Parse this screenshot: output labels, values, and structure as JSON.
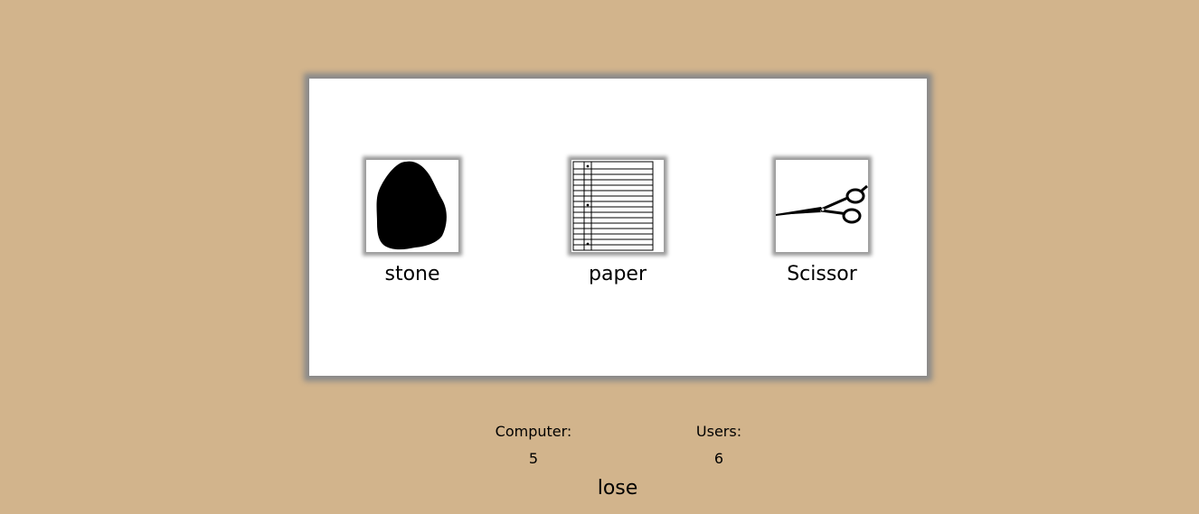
{
  "game": {
    "choices": [
      {
        "id": "stone",
        "label": "stone",
        "icon": "stone-icon"
      },
      {
        "id": "paper",
        "label": "paper",
        "icon": "paper-icon"
      },
      {
        "id": "scissor",
        "label": "Scissor",
        "icon": "scissor-icon"
      }
    ]
  },
  "score": {
    "computer_label": "Computer:",
    "computer_value": "5",
    "users_label": "Users:",
    "users_value": "6"
  },
  "result": "lose",
  "colors": {
    "background": "#d2b48c",
    "board": "#ffffff",
    "shadow": "#8a8a8a",
    "text": "#000000"
  }
}
